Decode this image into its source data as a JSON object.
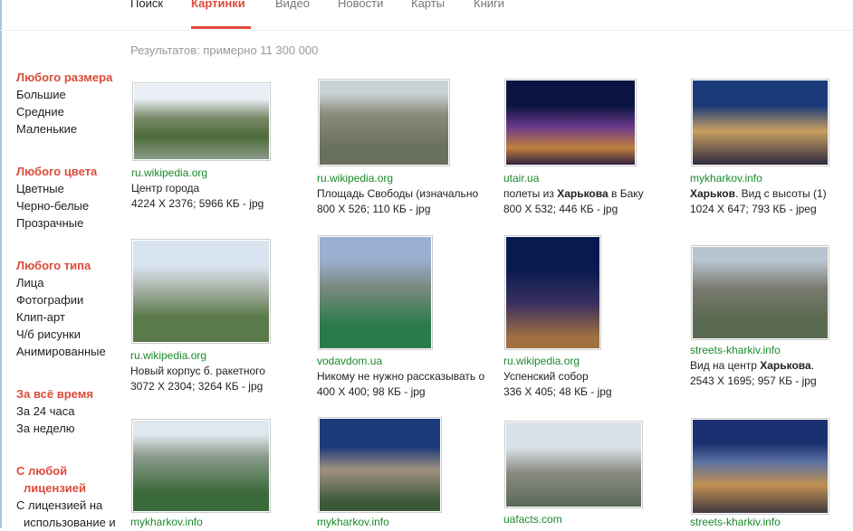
{
  "tabs": [
    "Поиск",
    "Картинки",
    "Видео",
    "Новости",
    "Карты",
    "Книги"
  ],
  "results": "Результатов: примерно 11 300 000",
  "sidebar": [
    {
      "header": "Любого размера",
      "items": [
        "Большие",
        "Средние",
        "Маленькие"
      ]
    },
    {
      "header": "Любого цвета",
      "items": [
        "Цветные",
        "Черно-белые",
        "Прозрачные"
      ]
    },
    {
      "header": "Любого типа",
      "items": [
        "Лица",
        "Фотографии",
        "Клип-арт",
        "Ч/б рисунки",
        "Анимированные"
      ]
    },
    {
      "header": "За всё время",
      "items": [
        "За 24 часа",
        "За неделю"
      ]
    },
    {
      "header": "С любой",
      "header2": "лицензией",
      "items": [
        "С лицензией на",
        "использование и"
      ]
    }
  ],
  "cards": [
    {
      "source": "ru.wikipedia.org",
      "t1": "Центр города",
      "b": "",
      "t2": "",
      "meta": "4224 X 2376; 5966 КБ - jpg"
    },
    {
      "source": "ru.wikipedia.org",
      "t1": "Площадь Свободы (изначально",
      "b": "",
      "t2": "",
      "meta": "800 X 526; 110 КБ - jpg"
    },
    {
      "source": "utair.ua",
      "t1": "полеты из ",
      "b": "Харькова",
      "t2": " в Баку",
      "meta": "800 X 532; 446 КБ - jpg"
    },
    {
      "source": "mykharkov.info",
      "t1": "",
      "b": "Харьков",
      "t2": ". Вид с высоты (1)",
      "meta": "1024 X 647; 793 КБ - jpeg"
    },
    {
      "source": "ru.wikipedia.org",
      "t1": "Новый корпус б. ракетного",
      "b": "",
      "t2": "",
      "meta": "3072 X 2304; 3264 КБ - jpg"
    },
    {
      "source": "vodavdom.ua",
      "t1": "Никому не нужно рассказывать о",
      "b": "",
      "t2": "",
      "meta": "400 X 400; 98 КБ - jpg"
    },
    {
      "source": "ru.wikipedia.org",
      "t1": "Успенский собор",
      "b": "",
      "t2": "",
      "meta": "336 X 405; 48 КБ - jpg"
    },
    {
      "source": "streets-kharkiv.info",
      "t1": "Вид на центр ",
      "b": "Харькова",
      "t2": ".",
      "meta": "2543 X 1695; 957 КБ - jpg"
    },
    {
      "source": "mykharkov.info",
      "t1": "",
      "b": "",
      "t2": "",
      "meta": ""
    },
    {
      "source": "mykharkov.info",
      "t1": "",
      "b": "",
      "t2": "",
      "meta": ""
    },
    {
      "source": "uafacts.com",
      "t1": "",
      "b": "",
      "t2": "",
      "meta": ""
    },
    {
      "source": "streets-kharkiv.info",
      "t1": "",
      "b": "",
      "t2": "",
      "meta": ""
    }
  ]
}
